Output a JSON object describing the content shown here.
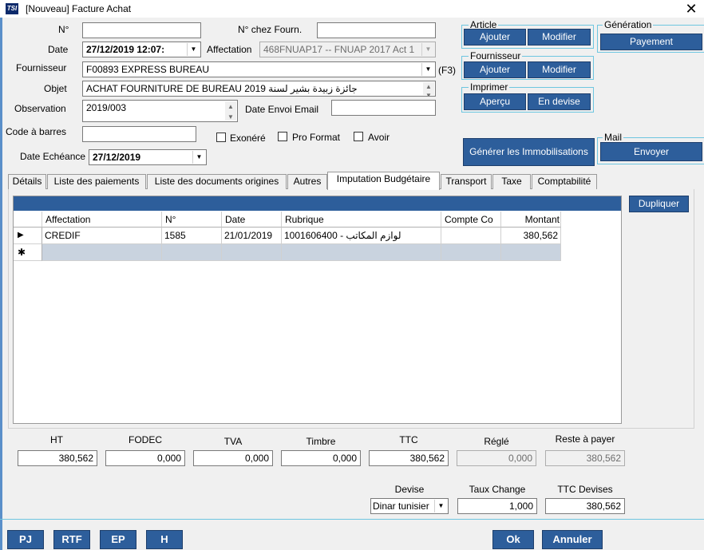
{
  "window": {
    "title": "[Nouveau] Facture Achat",
    "icon_text": "TSI",
    "close_glyph": "✕"
  },
  "form": {
    "no_label": "N°",
    "no_value": "",
    "no_fourn_label": "N° chez Fourn.",
    "no_fourn_value": "",
    "date_label": "Date",
    "date_value": "27/12/2019 12:07:",
    "affectation_label": "Affectation",
    "affectation_value": "468FNUAP17 -- FNUAP 2017 Act 1",
    "fournisseur_label": "Fournisseur",
    "fournisseur_value": "F00893 EXPRESS BUREAU",
    "fournisseur_hint": "(F3)",
    "objet_label": "Objet",
    "objet_value": "ACHAT FOURNITURE DE BUREAU 2019 جائزة زبيدة بشير لسنة",
    "observation_label": "Observation",
    "observation_value": "2019/003",
    "date_envoi_label": "Date Envoi Email",
    "date_envoi_value": "",
    "code_barres_label": "Code à barres",
    "code_barres_value": "",
    "exonere_label": "Exonéré",
    "pro_format_label": "Pro Format",
    "avoir_label": "Avoir",
    "date_echeance_label": "Date Echéance",
    "date_echeance_value": "27/12/2019"
  },
  "groups": {
    "article": {
      "title": "Article",
      "add": "Ajouter",
      "edit": "Modifier"
    },
    "generation": {
      "title": "Génération",
      "payement": "Payement"
    },
    "fournisseur": {
      "title": "Fournisseur",
      "add": "Ajouter",
      "edit": "Modifier"
    },
    "imprimer": {
      "title": "Imprimer",
      "apercu": "Aperçu",
      "devise": "En devise"
    },
    "generer_immo": "Générer les Immobilisations",
    "mail": {
      "title": "Mail",
      "envoyer": "Envoyer"
    }
  },
  "tabs": [
    "Détails",
    "Liste des paiements",
    "Liste des documents origines",
    "Autres",
    "Imputation Budgétaire",
    "Transport",
    "Taxe",
    "Comptabilité"
  ],
  "active_tab": "Imputation Budgétaire",
  "grid": {
    "dupliquer": "Dupliquer",
    "columns": [
      "Affectation",
      "N°",
      "Date",
      "Rubrique",
      "Compte Co",
      "Montant"
    ],
    "rows": [
      {
        "marker": "▶",
        "affectation": "CREDIF",
        "no": "1585",
        "date": "21/01/2019",
        "rubrique": "1001606400  -         لوازم المكاتب",
        "compte": "",
        "montant": "380,562"
      }
    ],
    "new_row_marker": "✱"
  },
  "totals": {
    "ht_label": "HT",
    "ht": "380,562",
    "fodec_label": "FODEC",
    "fodec": "0,000",
    "tva_label": "TVA",
    "tva": "0,000",
    "timbre_label": "Timbre",
    "timbre": "0,000",
    "ttc_label": "TTC",
    "ttc": "380,562",
    "regle_label": "Réglé",
    "regle": "0,000",
    "reste_label": "Reste à payer",
    "reste": "380,562",
    "devise_label": "Devise",
    "devise": "Dinar tunisier",
    "taux_label": "Taux Change",
    "taux": "1,000",
    "ttc_devises_label": "TTC Devises",
    "ttc_devises": "380,562"
  },
  "footer": {
    "pj": "PJ",
    "rtf": "RTF",
    "ep": "EP",
    "h": "H",
    "ok": "Ok",
    "annuler": "Annuler"
  }
}
